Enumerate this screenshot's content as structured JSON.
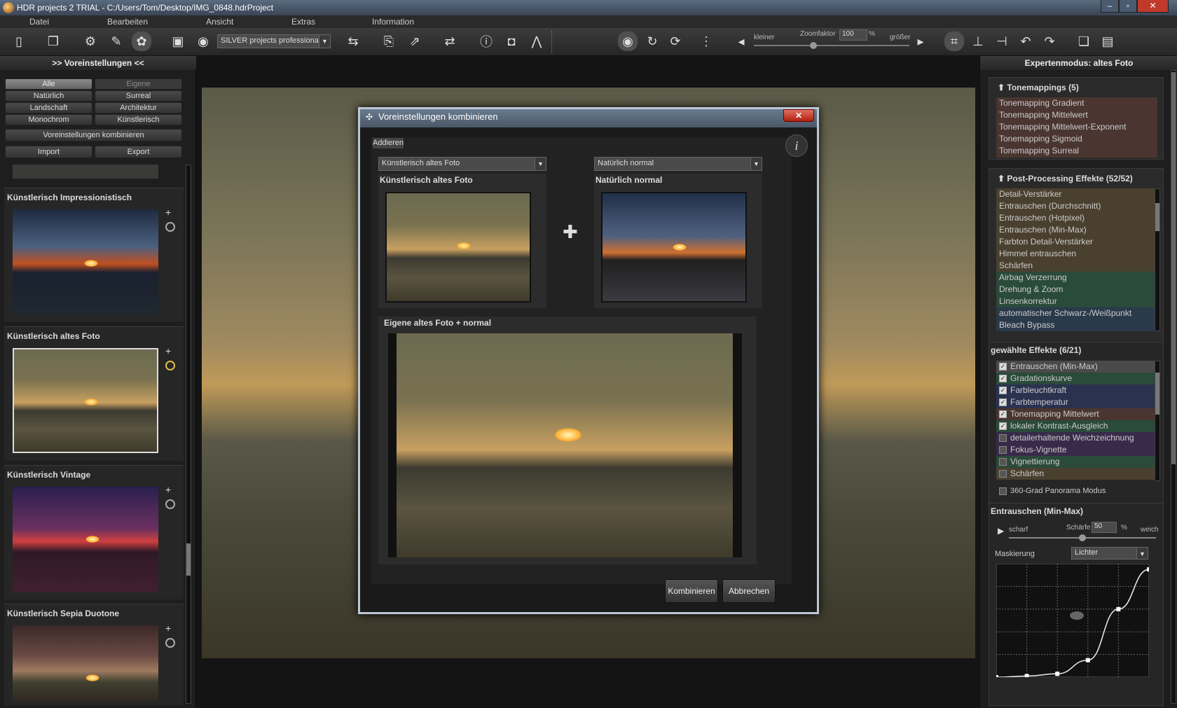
{
  "window": {
    "title": "HDR projects 2  TRIAL - C:/Users/Tom/Desktop/IMG_0848.hdrProject",
    "buttons": [
      "–",
      "▫",
      "✕"
    ]
  },
  "menu": [
    "Datei",
    "Bearbeiten",
    "Ansicht",
    "Extras",
    "Information"
  ],
  "toolbar": {
    "edition_select": "SILVER projects professional",
    "zoom_smaller": "kleiner",
    "zoom_label": "Zoomfaktor",
    "zoom_value": "100",
    "zoom_unit": "%",
    "zoom_larger": "größer"
  },
  "left_panel": {
    "title": ">> Voreinstellungen <<",
    "filters": [
      "Alle",
      "Eigene",
      "Natürlich",
      "Surreal",
      "Landschaft",
      "Architektur",
      "Monochrom",
      "Künstlerisch"
    ],
    "combine_button": "Voreinstellungen kombinieren",
    "import_button": "Import",
    "export_button": "Export",
    "presets": [
      {
        "title": "Künstlerisch Impressionistisch"
      },
      {
        "title": "Künstlerisch altes Foto"
      },
      {
        "title": "Künstlerisch Vintage"
      },
      {
        "title": "Künstlerisch Sepia Duotone"
      }
    ]
  },
  "dialog": {
    "title": "Voreinstellungen kombinieren",
    "mode_tab": "Addieren",
    "left_select": "Künstlerisch altes Foto",
    "right_select": "Natürlich normal",
    "left_label": "Künstlerisch altes Foto",
    "right_label": "Natürlich normal",
    "result_label": "Eigene altes Foto + normal",
    "plus_symbol": "✚",
    "combine_button": "Kombinieren",
    "cancel_button": "Abbrechen"
  },
  "right_panel": {
    "title": "Expertenmodus: altes Foto",
    "tonemappings": {
      "title": "Tonemappings (5)",
      "items": [
        "Tonemapping Gradient",
        "Tonemapping Mittelwert",
        "Tonemapping Mittelwert-Exponent",
        "Tonemapping Sigmoid",
        "Tonemapping Surreal"
      ]
    },
    "postprocessing": {
      "title": "Post-Processing Effekte (52/52)",
      "items": [
        "Detail-Verstärker",
        "Entrauschen (Durchschnitt)",
        "Entrauschen (Hotpixel)",
        "Entrauschen (Min-Max)",
        "Farbton Detail-Verstärker",
        "Himmel entrauschen",
        "Schärfen",
        "Airbag Verzerrung",
        "Drehung & Zoom",
        "Linsenkorrektur",
        "automatischer Schwarz-/Weißpunkt",
        "Bleach Bypass"
      ]
    },
    "selected": {
      "title": "gewählte Effekte (6/21)",
      "items": [
        {
          "label": "Entrauschen (Min-Max)",
          "checked": true
        },
        {
          "label": "Gradationskurve",
          "checked": true
        },
        {
          "label": "Farbleuchtkraft",
          "checked": true
        },
        {
          "label": "Farbtemperatur",
          "checked": true
        },
        {
          "label": "Tonemapping Mittelwert",
          "checked": true
        },
        {
          "label": "lokaler Kontrast-Ausgleich",
          "checked": true
        },
        {
          "label": "detailerhaltende Weichzeichnung",
          "checked": false
        },
        {
          "label": "Fokus-Vignette",
          "checked": false
        },
        {
          "label": "Vignettierung",
          "checked": false
        },
        {
          "label": "Schärfen",
          "checked": false
        }
      ],
      "panorama_label": "360-Grad Panorama Modus",
      "check_mark": "✓"
    },
    "effect": {
      "title": "Entrauschen (Min-Max)",
      "sharp_label": "scharf",
      "amount_label": "Schärfe",
      "amount_value": "50",
      "amount_unit": "%",
      "soft_label": "weich",
      "amount_fraction": 0.5,
      "mask_label": "Maskierung",
      "mask_value": "Lichter",
      "curve_points": [
        [
          0,
          0
        ],
        [
          0.2,
          0.01
        ],
        [
          0.4,
          0.03
        ],
        [
          0.6,
          0.15
        ],
        [
          0.8,
          0.6
        ],
        [
          1,
          0.95
        ]
      ]
    }
  },
  "colors": {
    "tonemap_bg": "#4a3530",
    "pp_green": "#2a4a3a",
    "pp_brown": "#4a4030",
    "sel_blue": "#2a3250",
    "sel_purple": "#3a2a4a",
    "sel_green": "#2a4a3a",
    "sel_brown": "#4a3530",
    "active_highlight": "#4a4a4a"
  }
}
